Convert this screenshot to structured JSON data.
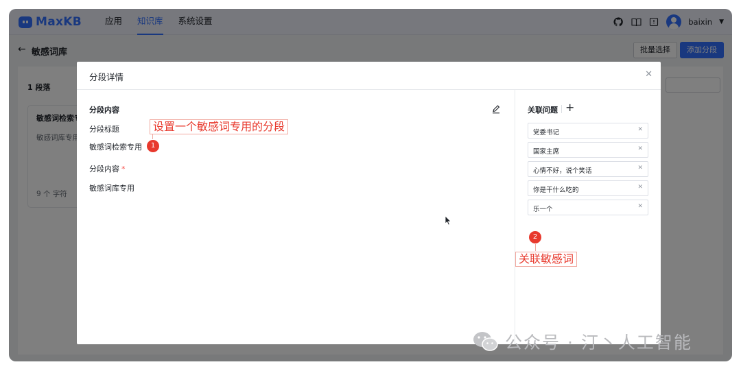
{
  "app": {
    "logo_text": "MaxKB",
    "nav": [
      "应用",
      "知识库",
      "系统设置"
    ],
    "active_nav_index": 1,
    "username": "baixin",
    "accent_color": "#3370ff"
  },
  "page": {
    "title": "敏感词库",
    "batch_select": "批量选择",
    "add_segment": "添加分段",
    "paragraph_count": "1 段落",
    "card": {
      "title": "敏感词检索专",
      "text": "敏感词库专用",
      "chars": "9 个 字符"
    }
  },
  "dialog": {
    "title": "分段详情",
    "close_icon": "close-icon",
    "section_title": "分段内容",
    "field_title_label": "分段标题",
    "field_title_value": "敏感词检索专用",
    "field_content_label": "分段内容",
    "field_content_required": "*",
    "field_content_value": "敏感词库专用",
    "related_title": "关联问题",
    "add_icon": "plus-icon",
    "questions": [
      "党委书记",
      "国家主席",
      "心情不好，说个笑话",
      "你是干什么吃的",
      "乐一个"
    ]
  },
  "annotations": {
    "callout1": "设置一个敏感词专用的分段",
    "badge1": "1",
    "callout2": "关联敏感词",
    "badge2": "2",
    "color": "#e8392d"
  },
  "watermark": "公众号 · 汀丶人工智能"
}
